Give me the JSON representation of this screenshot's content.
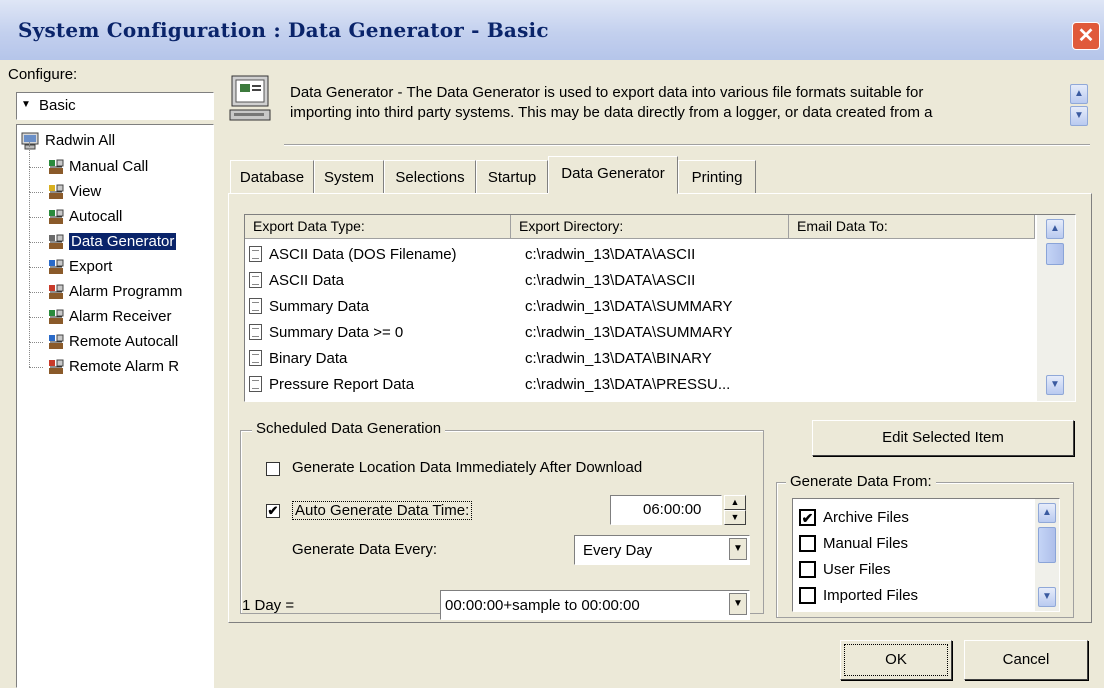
{
  "window": {
    "title": "System Configuration : Data Generator - Basic",
    "close_label": "✕"
  },
  "configure": {
    "label": "Configure:",
    "selected": "Basic",
    "tree": {
      "root": "Radwin All",
      "items": [
        "Manual Call",
        "View",
        "Autocall",
        "Data Generator",
        "Export",
        "Alarm Programm",
        "Alarm Receiver",
        "Remote Autocall",
        "Remote Alarm R"
      ],
      "selected_index": 3
    }
  },
  "description": {
    "line1": "Data Generator - The Data Generator is used to export data into various file formats suitable for",
    "line2": "importing into third party systems. This may be data directly from a logger, or data created from a"
  },
  "tabs": [
    "Database",
    "System",
    "Selections",
    "Startup",
    "Data Generator",
    "Printing"
  ],
  "active_tab": "Data Generator",
  "export_table": {
    "headers": [
      "Export Data Type:",
      "Export Directory:",
      "Email Data To:"
    ],
    "rows": [
      {
        "type": "ASCII Data (DOS Filename)",
        "dir": "c:\\radwin_13\\DATA\\ASCII"
      },
      {
        "type": "ASCII Data",
        "dir": "c:\\radwin_13\\DATA\\ASCII"
      },
      {
        "type": "Summary Data",
        "dir": "c:\\radwin_13\\DATA\\SUMMARY"
      },
      {
        "type": "Summary Data >= 0",
        "dir": "c:\\radwin_13\\DATA\\SUMMARY"
      },
      {
        "type": "Binary Data",
        "dir": "c:\\radwin_13\\DATA\\BINARY"
      },
      {
        "type": "Pressure Report Data",
        "dir": "c:\\radwin_13\\DATA\\PRESSU..."
      }
    ]
  },
  "scheduled": {
    "title": "Scheduled Data Generation",
    "immediate_label": "Generate Location Data Immediately After Download",
    "immediate_checked": false,
    "auto_label": "Auto Generate Data Time:",
    "auto_checked": true,
    "auto_time": "06:00:00",
    "every_label": "Generate Data Every:",
    "every_value": "Every Day"
  },
  "day": {
    "label": "1 Day =",
    "value": "00:00:00+sample to 00:00:00"
  },
  "edit_button": "Edit Selected Item",
  "generate_from": {
    "title": "Generate Data From:",
    "items": [
      {
        "label": "Archive Files",
        "checked": true
      },
      {
        "label": "Manual Files",
        "checked": false
      },
      {
        "label": "User Files",
        "checked": false
      },
      {
        "label": "Imported Files",
        "checked": false
      }
    ]
  },
  "buttons": {
    "ok": "OK",
    "cancel": "Cancel"
  },
  "check_mark": "✔",
  "colors": {
    "selection": "#0a246a",
    "title_text": "#0a246a",
    "close": "#e05a3a"
  }
}
